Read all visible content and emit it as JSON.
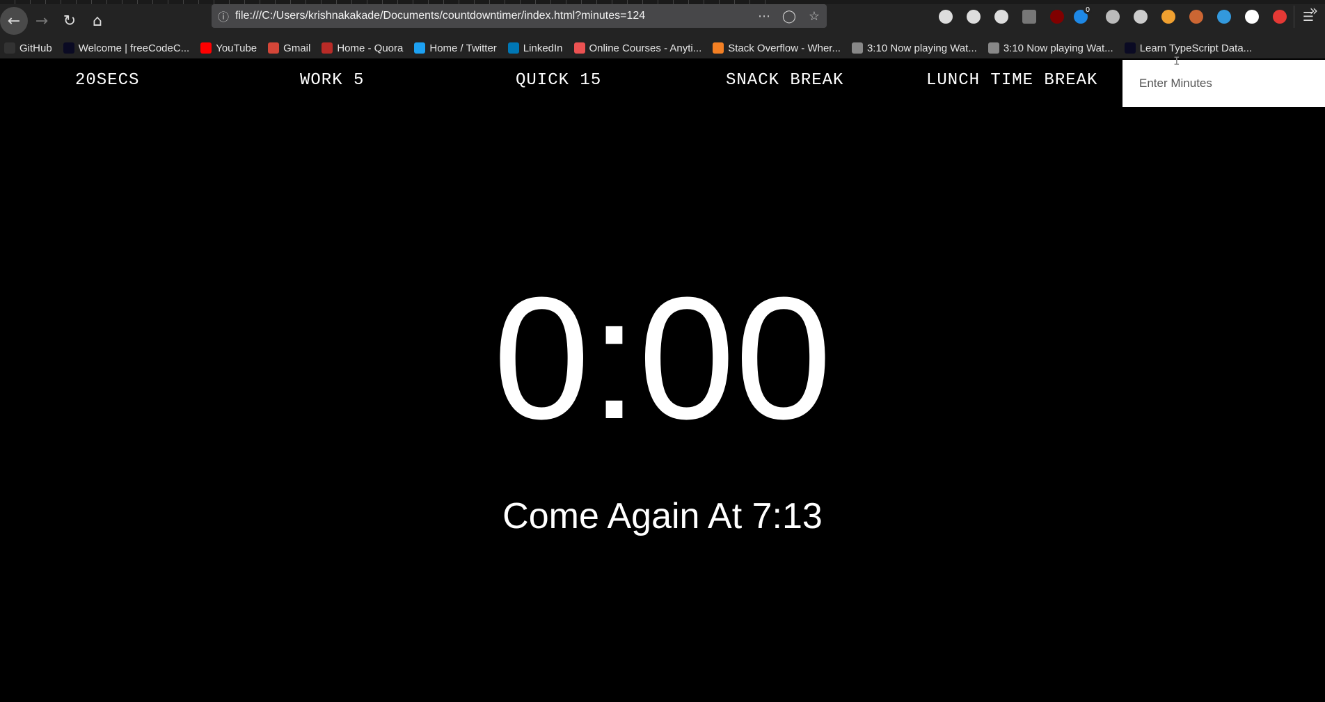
{
  "browser": {
    "url": "file:///C:/Users/krishnakakade/Documents/countdowntimer/index.html?minutes=124",
    "nav_icons": [
      "back-icon",
      "forward-icon",
      "reload-icon",
      "home-icon"
    ],
    "url_actions": [
      "more-actions-icon",
      "pocket-icon",
      "bookmark-star-icon"
    ],
    "toolbar_icons": [
      {
        "name": "library-icon",
        "color": "#dddddd"
      },
      {
        "name": "sidebar-icon",
        "color": "#dddddd"
      },
      {
        "name": "account-icon",
        "color": "#dddddd"
      },
      {
        "name": "extension-gray-icon",
        "color": "#777777"
      },
      {
        "name": "ublock-icon",
        "color": "#800000"
      },
      {
        "name": "ghostery-icon",
        "color": "#1e88e5"
      },
      {
        "name": "extension-bird-icon",
        "color": "#bbbbbb"
      },
      {
        "name": "privacy-badger-icon",
        "color": "#cccccc"
      },
      {
        "name": "extension-orange-icon",
        "color": "#f0a030"
      },
      {
        "name": "extension-glasses-icon",
        "color": "#cc6633"
      },
      {
        "name": "extension-blue-icon",
        "color": "#3399dd"
      },
      {
        "name": "extension-pin-icon",
        "color": "#ffffff"
      },
      {
        "name": "extension-close-icon",
        "color": "#e53935"
      }
    ],
    "ghostery_badge": "0",
    "menu_icon": "hamburger-menu-icon"
  },
  "bookmarks": [
    {
      "label": "GitHub",
      "icon": "github-icon",
      "color": "#333333"
    },
    {
      "label": "Welcome | freeCodeC...",
      "icon": "freecodecamp-icon",
      "color": "#0a0a23"
    },
    {
      "label": "YouTube",
      "icon": "youtube-icon",
      "color": "#ff0000"
    },
    {
      "label": "Gmail",
      "icon": "gmail-icon",
      "color": "#d44638"
    },
    {
      "label": "Home - Quora",
      "icon": "quora-icon",
      "color": "#b92b27"
    },
    {
      "label": "Home / Twitter",
      "icon": "twitter-icon",
      "color": "#1da1f2"
    },
    {
      "label": "LinkedIn",
      "icon": "linkedin-icon",
      "color": "#0077b5"
    },
    {
      "label": "Online Courses - Anyti...",
      "icon": "udemy-icon",
      "color": "#ec5252"
    },
    {
      "label": "Stack Overflow - Wher...",
      "icon": "stackoverflow-icon",
      "color": "#f48024"
    },
    {
      "label": "3:10 Now playing Wat...",
      "icon": "globe-icon",
      "color": "#888888"
    },
    {
      "label": "3:10 Now playing Wat...",
      "icon": "globe-icon",
      "color": "#888888"
    },
    {
      "label": "Learn TypeScript Data...",
      "icon": "freecodecamp-icon",
      "color": "#0a0a23"
    }
  ],
  "timer_controls": {
    "buttons": [
      "20SECS",
      "WORK 5",
      "QUICK 15",
      "SNACK BREAK",
      "LUNCH TIME BREAK"
    ],
    "input_placeholder": "Enter Minutes"
  },
  "display": {
    "time_left": "0:00",
    "end_time": "Come Again At 7:13"
  },
  "colors": {
    "page_background": "#000000",
    "text": "#ffffff",
    "browser_chrome": "#232323"
  }
}
